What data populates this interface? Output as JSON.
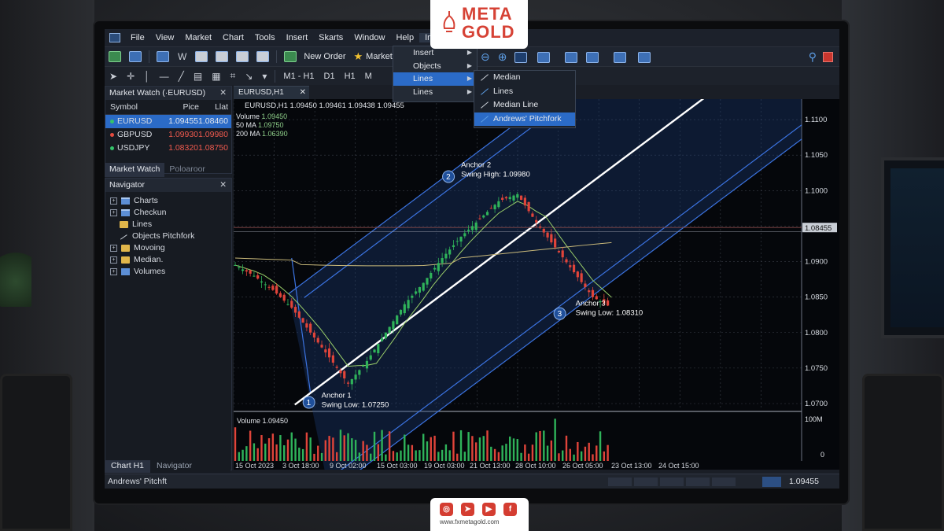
{
  "menu": [
    "File",
    "View",
    "Market",
    "Chart",
    "Tools",
    "Insert",
    "Skarts",
    "Window",
    "Help",
    "Insert"
  ],
  "toolbar": {
    "new_order": "New Order",
    "market": "Market",
    "tb_w": "W"
  },
  "timeframes": [
    "M1 - H1",
    "D1",
    "H1",
    "M"
  ],
  "insert_menu": [
    {
      "label": "Insert",
      "arrow": true
    },
    {
      "label": "Objects",
      "arrow": true
    },
    {
      "label": "Lines",
      "arrow": true,
      "highlight": true
    },
    {
      "label": "Lines",
      "arrow": true
    }
  ],
  "lines_submenu": [
    {
      "label": "Median",
      "icon": "line-icon"
    },
    {
      "label": "Lines",
      "icon": "line-icon"
    },
    {
      "label": "Median Line",
      "icon": "line-icon"
    },
    {
      "label": "Andrews' Pitchfork",
      "icon": "line-icon",
      "highlight": true
    }
  ],
  "market_watch": {
    "title": "Market Watch (·EURUSD)",
    "columns": [
      "Symbol",
      "Pice",
      "Llat"
    ],
    "rows": [
      {
        "symbol": "EURUSD",
        "bid": "1.09455",
        "ask": "1.08460",
        "selected": true,
        "dir": "up"
      },
      {
        "symbol": "GBPUSD",
        "bid": "1.09930",
        "ask": "1.09980",
        "selected": false,
        "dir": "down"
      },
      {
        "symbol": "USDJPY",
        "bid": "1.08320",
        "ask": "1.08750",
        "selected": false,
        "dir": "up"
      }
    ],
    "tabs": [
      "Market Watch",
      "Poloaroor"
    ]
  },
  "navigator": {
    "title": "Navigator",
    "items": [
      {
        "label": "Charts",
        "icon": "window-icon",
        "expand": "+"
      },
      {
        "label": "Checkun",
        "icon": "window-icon",
        "expand": "+"
      },
      {
        "label": "Lines",
        "icon": "folder-icon",
        "expand": ""
      },
      {
        "label": "Objects Pitchfork",
        "icon": "line-icon",
        "expand": ""
      },
      {
        "label": "Movoing",
        "icon": "folder-icon",
        "expand": "+"
      },
      {
        "label": "Median.",
        "icon": "folder-icon",
        "expand": "+"
      },
      {
        "label": "Volumes",
        "icon": "volume-icon",
        "expand": "+"
      }
    ]
  },
  "bottom_tabs": [
    "Chart H1",
    "Navigator"
  ],
  "status": {
    "left": "Andrews' Pitchft",
    "right": "1.09455"
  },
  "chart": {
    "tab": "EURUSD,H1",
    "header": "EURUSD,H1  1.09450  1.09461  1.09438  1.09455",
    "legend": [
      {
        "name": "Volume",
        "value": "1.09450"
      },
      {
        "name": "50 MA",
        "value": "1.09750"
      },
      {
        "name": "200 MA",
        "value": "1.06390"
      }
    ],
    "volume_label": "Volume  1.09450",
    "price_badge": "1.08455",
    "anchors": [
      {
        "num": "1",
        "title": "Anchor 1",
        "desc": "Swing Low: 1.07250"
      },
      {
        "num": "2",
        "title": "Anchor 2",
        "desc": "Swing High: 1.09980"
      },
      {
        "num": "3",
        "title": "Anchor 3",
        "desc": "Swing Low: 1.08310"
      }
    ]
  },
  "chart_data": {
    "type": "line",
    "series": [
      {
        "x": [
          0,
          12,
          24,
          36,
          48,
          60,
          72,
          84,
          96,
          108,
          120,
          132,
          144,
          156,
          168,
          180,
          192,
          204,
          216,
          228,
          240,
          252,
          264,
          276,
          288,
          300
        ],
        "y": [
          1.0895,
          1.088,
          1.086,
          1.0835,
          1.08,
          1.0765,
          1.0728,
          1.076,
          1.08,
          1.084,
          1.087,
          1.0905,
          1.0935,
          1.096,
          1.0985,
          1.0995,
          1.0955,
          1.092,
          1.0885,
          1.085,
          1.0835,
          1.087,
          1.0895,
          1.092,
          1.0945,
          1.094
        ]
      }
    ],
    "y_ticks": [
      "1.1100",
      "1.1050",
      "1.1000",
      "1.0950",
      "1.0900",
      "1.0850",
      "1.0800",
      "1.0750",
      "1.0700"
    ],
    "ylim": [
      1.07,
      1.112
    ],
    "x_ticks": [
      "15 Oct 2023",
      "3 Oct 18:00",
      "9 Oct 02:00",
      "15 Oct 03:00",
      "19 Oct 03:00",
      "21 Oct 13:00",
      "28 Oct 10:00",
      "26 Oct 05:00",
      "23 Oct 13:00",
      "24 Oct 15:00"
    ],
    "volume_ticks": [
      "100M",
      "0"
    ]
  },
  "colors": {
    "accent": "#2b6bc7",
    "bull": "#2fb35a",
    "bear": "#e0443a",
    "channel": "#3b73e0",
    "median": "#ffffff"
  }
}
